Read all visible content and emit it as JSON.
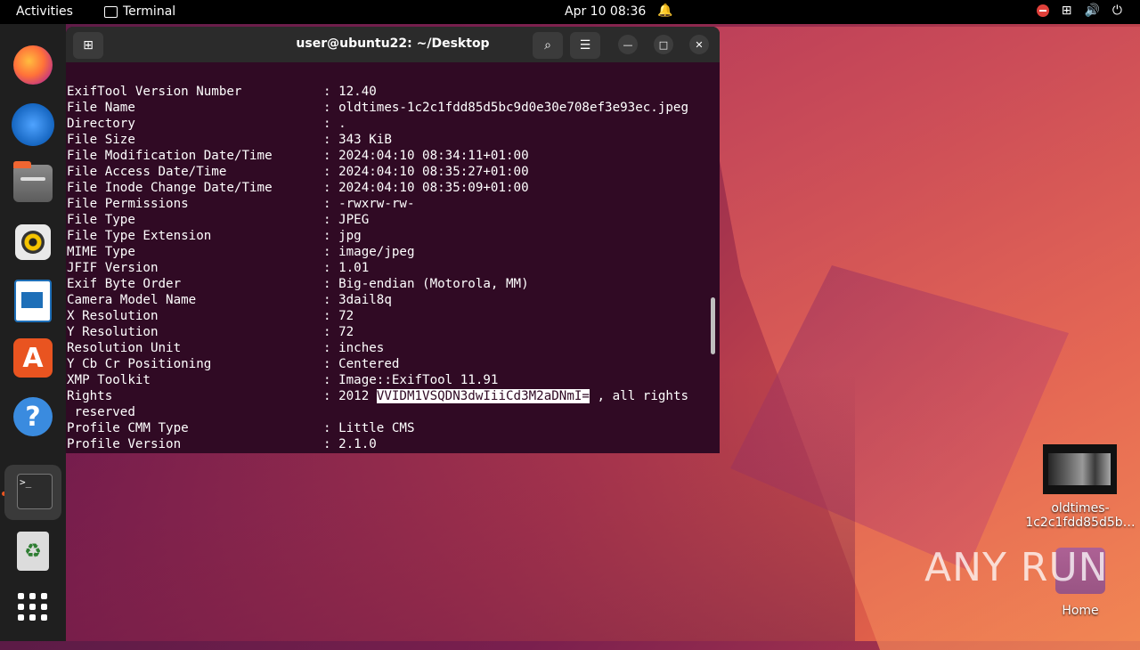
{
  "topbar": {
    "activities": "Activities",
    "app_name": "Terminal",
    "clock": "Apr 10  08:36"
  },
  "dock": {
    "items": [
      {
        "name": "firefox"
      },
      {
        "name": "thunderbird"
      },
      {
        "name": "files"
      },
      {
        "name": "rhythmbox"
      },
      {
        "name": "libreoffice-writer"
      },
      {
        "name": "app-center"
      },
      {
        "name": "help"
      },
      {
        "name": "terminal"
      },
      {
        "name": "trash"
      },
      {
        "name": "show-apps"
      }
    ]
  },
  "terminal": {
    "title": "user@ubuntu22: ~/Desktop",
    "lines": [
      {
        "key": "ExifTool Version Number",
        "value": "12.40"
      },
      {
        "key": "File Name",
        "value": "oldtimes-1c2c1fdd85d5bc9d0e30e708ef3e93ec.jpeg"
      },
      {
        "key": "Directory",
        "value": "."
      },
      {
        "key": "File Size",
        "value": "343 KiB"
      },
      {
        "key": "File Modification Date/Time",
        "value": "2024:04:10 08:34:11+01:00"
      },
      {
        "key": "File Access Date/Time",
        "value": "2024:04:10 08:35:27+01:00"
      },
      {
        "key": "File Inode Change Date/Time",
        "value": "2024:04:10 08:35:09+01:00"
      },
      {
        "key": "File Permissions",
        "value": "-rwxrw-rw-"
      },
      {
        "key": "File Type",
        "value": "JPEG"
      },
      {
        "key": "File Type Extension",
        "value": "jpg"
      },
      {
        "key": "MIME Type",
        "value": "image/jpeg"
      },
      {
        "key": "JFIF Version",
        "value": "1.01"
      },
      {
        "key": "Exif Byte Order",
        "value": "Big-endian (Motorola, MM)"
      },
      {
        "key": "Camera Model Name",
        "value": "3dail8q"
      },
      {
        "key": "X Resolution",
        "value": "72"
      },
      {
        "key": "Y Resolution",
        "value": "72"
      },
      {
        "key": "Resolution Unit",
        "value": "inches"
      },
      {
        "key": "Y Cb Cr Positioning",
        "value": "Centered"
      },
      {
        "key": "XMP Toolkit",
        "value": "Image::ExifTool 11.91"
      }
    ],
    "rights": {
      "key": "Rights",
      "prefix": "2012 ",
      "selected": "VVIDM1VSQDN3dwIiiCd3M2aDNmI=",
      "suffix": " , all rights",
      "continuation": " reserved"
    },
    "tail_lines": [
      {
        "key": "Profile CMM Type",
        "value": "Little CMS"
      },
      {
        "key": "Profile Version",
        "value": "2.1.0"
      }
    ]
  },
  "desktop": {
    "file_label_1": "oldtimes-",
    "file_label_2": "1c2c1fdd85d5b…",
    "home_label": "Home",
    "watermark": "ANY RUN"
  }
}
